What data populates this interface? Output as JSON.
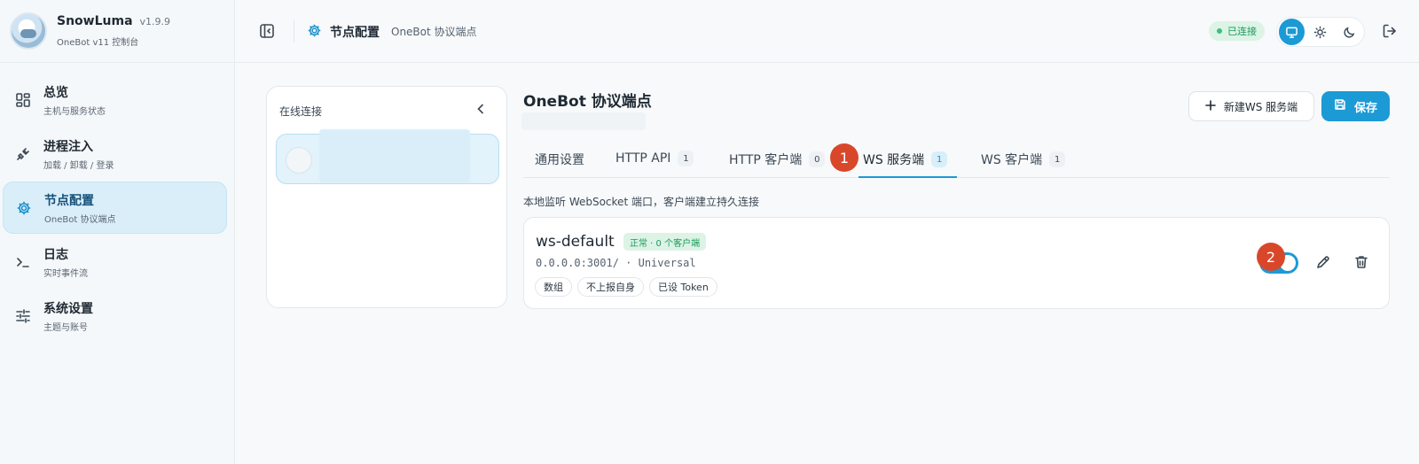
{
  "brand": {
    "name": "SnowLuma",
    "version": "v1.9.9",
    "subtitle": "OneBot v11 控制台"
  },
  "sidebar": {
    "items": [
      {
        "label": "总览",
        "sub": "主机与服务状态",
        "icon": "dashboard-grid-icon",
        "active": false
      },
      {
        "label": "进程注入",
        "sub": "加载 / 卸载 / 登录",
        "icon": "plug-icon",
        "active": false
      },
      {
        "label": "节点配置",
        "sub": "OneBot 协议端点",
        "icon": "gear-icon",
        "active": true
      },
      {
        "label": "日志",
        "sub": "实时事件流",
        "icon": "terminal-icon",
        "active": false
      },
      {
        "label": "系统设置",
        "sub": "主题与账号",
        "icon": "sliders-icon",
        "active": false
      }
    ]
  },
  "header": {
    "title": "节点配置",
    "subtitle": "OneBot 协议端点",
    "status": "已连接",
    "theme_options": [
      "monitor-icon",
      "sun-icon",
      "moon-icon"
    ],
    "active_theme": "monitor-icon"
  },
  "connections": {
    "title": "在线连接"
  },
  "main": {
    "title": "OneBot 协议端点",
    "new_button": "新建WS 服务端",
    "save_button": "保存",
    "tabs": [
      {
        "label": "通用设置",
        "count": ""
      },
      {
        "label": "HTTP API",
        "count": "1"
      },
      {
        "label": "HTTP 客户端",
        "count": "0"
      },
      {
        "label": "WS 服务端",
        "count": "1"
      },
      {
        "label": "WS 客户端",
        "count": "1"
      }
    ],
    "active_tab": "WS 服务端",
    "description": "本地监听 WebSocket 端口，客户端建立持久连接",
    "server": {
      "name": "ws-default",
      "status": "正常 · 0 个客户端",
      "address": "0.0.0.0:3001/ · Universal",
      "tags": [
        "数组",
        "不上报自身",
        "已设 Token"
      ],
      "enabled": true
    }
  },
  "markers": [
    "1",
    "2"
  ],
  "colors": {
    "accent": "#1c9ad6",
    "success": "#1d9a5c",
    "marker": "#d9472b"
  }
}
